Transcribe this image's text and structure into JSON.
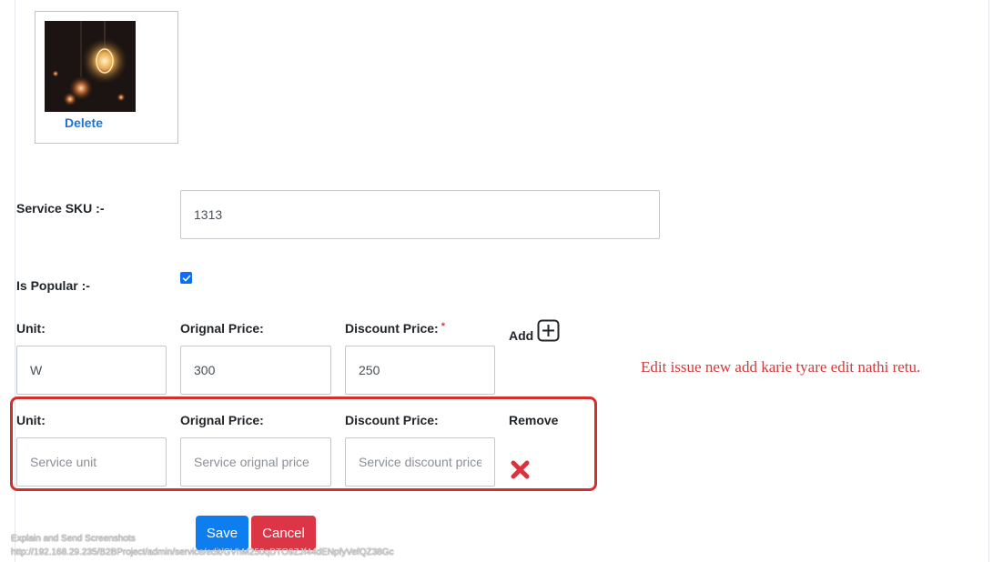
{
  "image_section": {
    "delete_label": "Delete"
  },
  "service_sku": {
    "label": "Service SKU :-",
    "value": "1313"
  },
  "is_popular": {
    "label": "Is Popular :-",
    "checked": true
  },
  "price_row_1": {
    "unit_label": "Unit:",
    "original_label": "Orignal Price:",
    "discount_label": "Discount Price:",
    "required_mark": "*",
    "add_label": "Add",
    "unit_value": "W",
    "original_value": "300",
    "discount_value": "250"
  },
  "price_row_2": {
    "unit_label": "Unit:",
    "original_label": "Orignal Price:",
    "discount_label": "Discount Price:",
    "remove_label": "Remove",
    "unit_placeholder": "Service unit",
    "original_placeholder": "Service orignal price",
    "discount_placeholder": "Service discount price"
  },
  "annotation_note": "Edit issue new add karie tyare edit nathi retu.",
  "actions": {
    "save_label": "Save",
    "cancel_label": "Cancel"
  },
  "status_bar": {
    "line1": "Explain and Send Screenshots",
    "line2": "http://192.168.29.235/B2BProject/admin/service/edit/GVhM250qDTO9ZJf44dENpfyVefQZ38Gc"
  },
  "colors": {
    "primary": "#0d7df0",
    "danger": "#dc3545",
    "annotation": "#d22f2f"
  },
  "icons": {
    "add": "plus-square-icon",
    "remove": "x-icon",
    "check": "check-icon"
  }
}
